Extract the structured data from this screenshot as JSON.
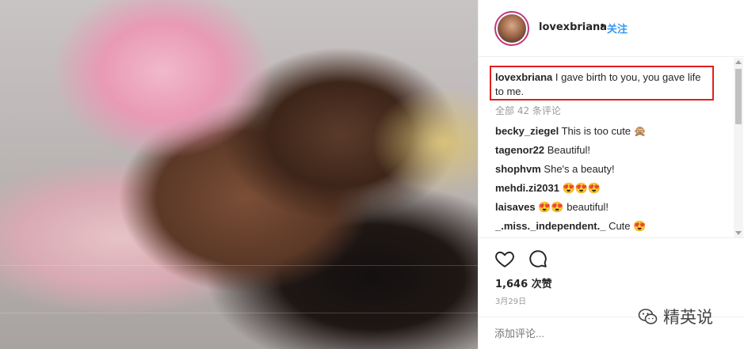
{
  "post": {
    "username": "lovexbriana",
    "separator": "•",
    "follow_label": "关注",
    "caption": "I gave birth to you, you gave life to me.",
    "all_comments_label": "全部 42 条评论",
    "comments": [
      {
        "user": "becky_ziegel",
        "text": "This is too cute 🙊"
      },
      {
        "user": "tagenor22",
        "text": "Beautiful!"
      },
      {
        "user": "shophvm",
        "text": "She's a beauty!"
      },
      {
        "user": "mehdi.zi2031",
        "text": "😍😍😍"
      },
      {
        "user": "laisaves",
        "text": "😍😍 beautiful!"
      },
      {
        "user": "_.miss._independent._",
        "text": "Cute 😍"
      }
    ],
    "likes": "1,646 次赞",
    "date": "3月29日",
    "add_comment_placeholder": "添加评论..."
  },
  "watermark": {
    "text": "精英说",
    "icon": "wechat-icon"
  },
  "icons": {
    "like": "heart-outline-icon",
    "comment": "comment-bubble-icon"
  },
  "colors": {
    "accent": "#3897f0",
    "highlight_border": "#e11f1f",
    "text": "#262626",
    "muted": "#999999"
  }
}
